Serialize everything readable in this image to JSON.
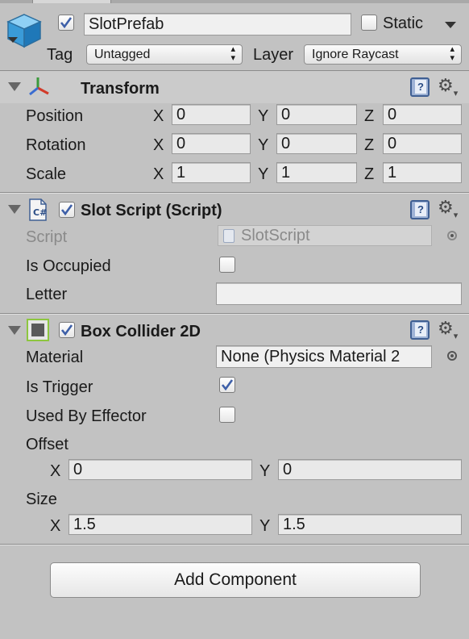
{
  "object": {
    "name": "SlotPrefab",
    "active": true,
    "static_label": "Static",
    "static": false,
    "tag_label": "Tag",
    "tag_value": "Untagged",
    "layer_label": "Layer",
    "layer_value": "Ignore Raycast"
  },
  "transform": {
    "title": "Transform",
    "rows": [
      {
        "label": "Position",
        "x": "0",
        "y": "0",
        "z": "0"
      },
      {
        "label": "Rotation",
        "x": "0",
        "y": "0",
        "z": "0"
      },
      {
        "label": "Scale",
        "x": "1",
        "y": "1",
        "z": "1"
      }
    ],
    "axis": {
      "x": "X",
      "y": "Y",
      "z": "Z"
    }
  },
  "slot_script": {
    "title": "Slot Script (Script)",
    "enabled": true,
    "script_label": "Script",
    "script_value": "SlotScript",
    "occupied_label": "Is Occupied",
    "occupied": false,
    "letter_label": "Letter",
    "letter_value": ""
  },
  "box_collider": {
    "title": "Box Collider 2D",
    "enabled": true,
    "material_label": "Material",
    "material_value": "None (Physics Material 2",
    "trigger_label": "Is Trigger",
    "is_trigger": true,
    "effector_label": "Used By Effector",
    "used_by_effector": false,
    "offset_label": "Offset",
    "offset": {
      "x": "0",
      "y": "0"
    },
    "size_label": "Size",
    "size": {
      "x": "1.5",
      "y": "1.5"
    },
    "axis": {
      "x": "X",
      "y": "Y"
    }
  },
  "add_component_label": "Add Component",
  "colors": {
    "background": "#c2c2c2",
    "check_blue": "#3d5fa8",
    "help_icon": "#3f5f93",
    "collider_icon_border": "#8dc63f"
  }
}
